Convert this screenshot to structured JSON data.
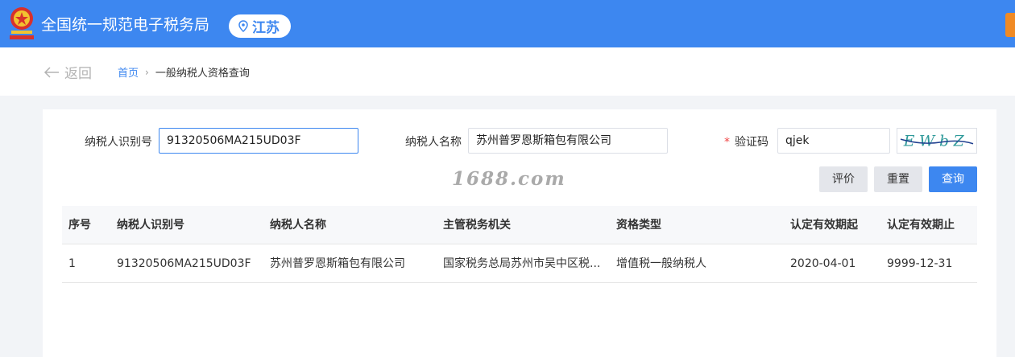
{
  "header": {
    "site_title": "全国统一规范电子税务局",
    "region": "江苏",
    "icons": {
      "emblem": "tax-emblem-icon",
      "location": "location-pin-icon"
    },
    "colors": {
      "bar": "#3d87f0",
      "accent_tab": "#f08a24"
    }
  },
  "nav": {
    "back_label": "返回",
    "breadcrumb": {
      "home": "首页",
      "current": "一般纳税人资格查询"
    }
  },
  "form": {
    "taxpayer_id": {
      "label": "纳税人识别号",
      "value": "91320506MA215UD03F"
    },
    "taxpayer_name": {
      "label": "纳税人名称",
      "value": "苏州普罗恩斯箱包有限公司"
    },
    "captcha": {
      "required_mark": "*",
      "label": "验证码",
      "value": "qjek",
      "image_text": "EWbZ"
    }
  },
  "watermark": "1688.com",
  "buttons": {
    "rate": "评价",
    "reset": "重置",
    "query": "查询"
  },
  "table": {
    "columns": [
      "序号",
      "纳税人识别号",
      "纳税人名称",
      "主管税务机关",
      "资格类型",
      "认定有效期起",
      "认定有效期止"
    ],
    "rows": [
      [
        "1",
        "91320506MA215UD03F",
        "苏州普罗恩斯箱包有限公司",
        "国家税务总局苏州市吴中区税...",
        "增值税一般纳税人",
        "2020-04-01",
        "9999-12-31"
      ]
    ]
  }
}
